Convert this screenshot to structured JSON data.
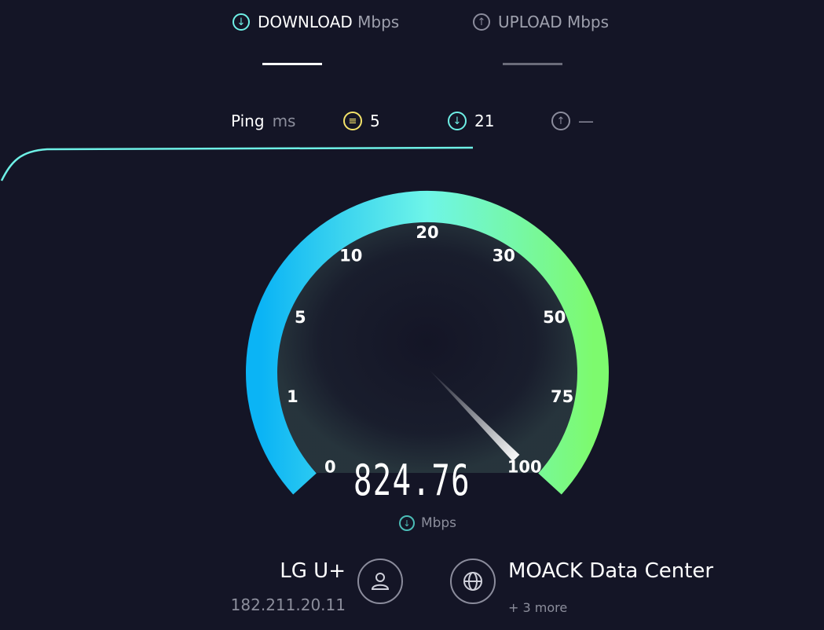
{
  "tabs": {
    "download": {
      "label": "DOWNLOAD",
      "unit": "Mbps",
      "icon": "arrow-down-icon",
      "active": true
    },
    "upload": {
      "label": "UPLOAD",
      "unit": "Mbps",
      "icon": "arrow-up-icon",
      "active": false
    }
  },
  "ping": {
    "label": "Ping",
    "unit": "ms",
    "idle": {
      "value": "5",
      "icon": "idle-latency-icon"
    },
    "download": {
      "value": "21",
      "icon": "arrow-down-icon"
    },
    "upload": {
      "value": "—",
      "icon": "arrow-up-icon"
    }
  },
  "gauge": {
    "ticks": [
      "0",
      "1",
      "5",
      "10",
      "20",
      "30",
      "50",
      "75",
      "100"
    ],
    "needle_value_mbps": 824.76,
    "reading": "824.76",
    "unit": "Mbps",
    "colors": {
      "start": "#0bb4f5",
      "mid": "#6ef5e8",
      "end": "#7dfa6e"
    }
  },
  "isp": {
    "name": "LG U+",
    "ip": "182.211.20.11",
    "icon": "user-icon"
  },
  "server": {
    "name": "MOACK Data Center",
    "more": "+ 3 more",
    "icon": "globe-icon"
  },
  "colors": {
    "background": "#141526",
    "accent": "#6ef0e6",
    "ping_idle": "#f4e36a",
    "muted": "#8c8e9c"
  }
}
